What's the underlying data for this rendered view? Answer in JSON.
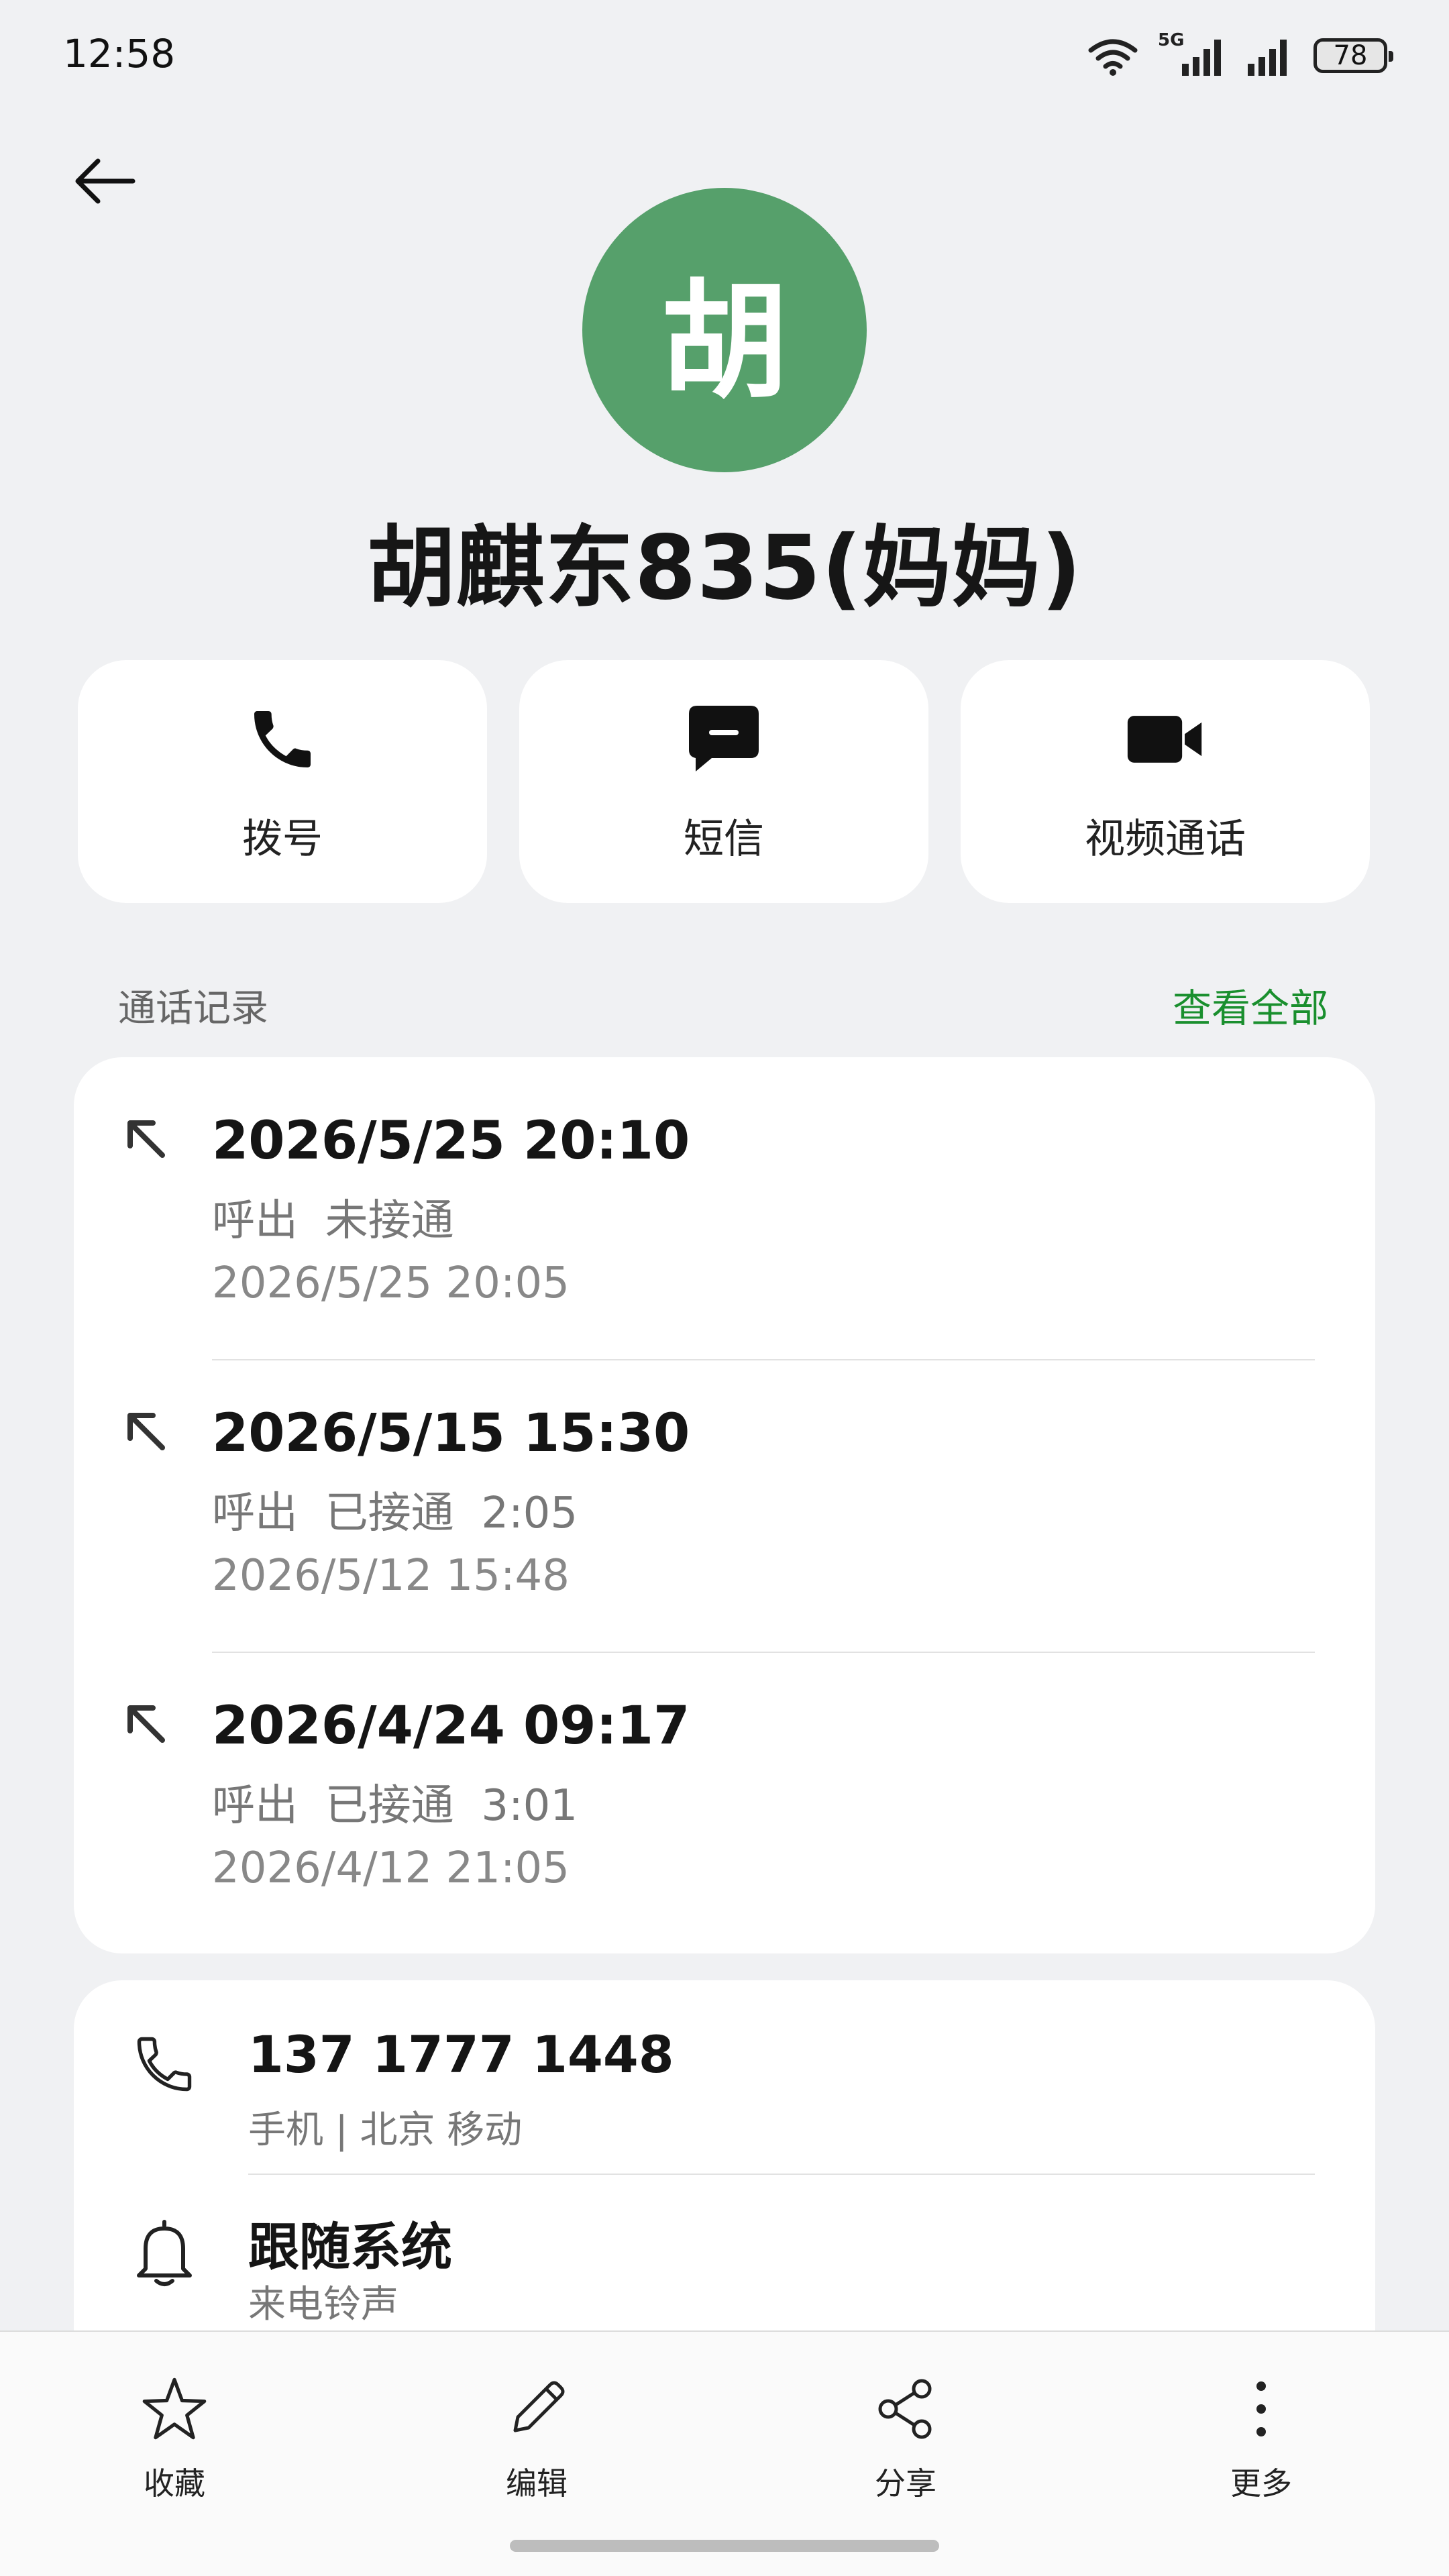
{
  "status_bar": {
    "time": "12:58",
    "network": "5G",
    "battery": "78",
    "icons": [
      "wifi-icon",
      "cellular-signal-5g-icon",
      "cellular-signal-icon",
      "battery-icon"
    ]
  },
  "header": {
    "back_icon": "arrow-left-icon",
    "avatar_letter": "胡",
    "avatar_color": "#56a06b",
    "contact_name": "胡麒东835(妈妈)"
  },
  "actions": [
    {
      "label": "拨号",
      "icon": "phone-icon"
    },
    {
      "label": "短信",
      "icon": "message-icon"
    },
    {
      "label": "视频通话",
      "icon": "video-camera-icon"
    }
  ],
  "call_log": {
    "title": "通话记录",
    "view_all": "查看全部",
    "accent_color": "#1a8f2e",
    "entries": [
      {
        "time": "2026/5/25 20:10",
        "status": "呼出  未接通",
        "sub": "2026/5/25 20:05",
        "icon": "outgoing-call-arrow-icon"
      },
      {
        "time": "2026/5/15 15:30",
        "status": "呼出  已接通  2:05",
        "sub": "2026/5/12 15:48",
        "icon": "outgoing-call-arrow-icon"
      },
      {
        "time": "2026/4/24 09:17",
        "status": "呼出  已接通  3:01",
        "sub": "2026/4/12 21:05",
        "icon": "outgoing-call-arrow-icon"
      }
    ]
  },
  "info": {
    "phone": {
      "number": "137 1777 1448",
      "detail": "手机 | 北京 移动",
      "icon": "phone-outline-icon"
    },
    "ringtone": {
      "value": "跟随系统",
      "label": "来电铃声",
      "icon": "bell-icon"
    }
  },
  "toolbar": [
    {
      "label": "收藏",
      "icon": "star-icon"
    },
    {
      "label": "编辑",
      "icon": "pencil-icon"
    },
    {
      "label": "分享",
      "icon": "share-icon"
    },
    {
      "label": "更多",
      "icon": "more-vertical-icon"
    }
  ]
}
